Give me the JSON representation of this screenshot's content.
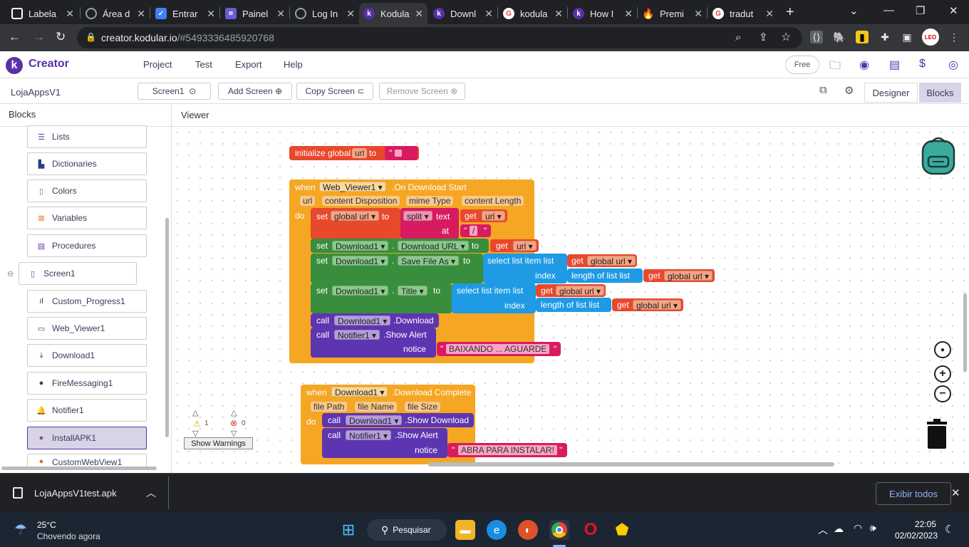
{
  "browser": {
    "tabs": [
      {
        "title": "Labela",
        "icon": "square-icon",
        "color": "#ffffff"
      },
      {
        "title": "Área d",
        "icon": "globe-icon",
        "color": "#9aa0a6"
      },
      {
        "title": "Entrar",
        "icon": "check-shield-icon",
        "color": "#3b82f6"
      },
      {
        "title": "Painel",
        "icon": "brackets-icon",
        "color": "#6b5bd6"
      },
      {
        "title": "Log In",
        "icon": "globe-icon",
        "color": "#9aa0a6"
      },
      {
        "title": "Kodula",
        "icon": "kodular-icon",
        "color": "#5930a5"
      },
      {
        "title": "Downl",
        "icon": "kodular-icon",
        "color": "#5930a5"
      },
      {
        "title": "kodula",
        "icon": "google-icon",
        "color": "#ea4335"
      },
      {
        "title": "How I",
        "icon": "kodular-icon",
        "color": "#5930a5"
      },
      {
        "title": "Premi",
        "icon": "flame-icon",
        "color": "#f59e0b"
      },
      {
        "title": "tradut",
        "icon": "google-icon",
        "color": "#ea4335"
      }
    ],
    "url_host": "creator.kodular.io",
    "url_path": "/#5493336485920768"
  },
  "app": {
    "brand": "Creator",
    "menu": [
      "Project",
      "Test",
      "Export",
      "Help"
    ],
    "plan_badge": "Free",
    "project_name": "LojaAppsV1",
    "screen_select": "Screen1",
    "add_screen": "Add Screen",
    "copy_screen": "Copy Screen",
    "remove_screen": "Remove Screen",
    "designer": "Designer",
    "blocks_mode": "Blocks"
  },
  "blocks_panel": {
    "title": "Blocks",
    "items": [
      {
        "label": "Lists",
        "icon": "list-icon",
        "color": "#3f51b5"
      },
      {
        "label": "Dictionaries",
        "icon": "dictionary-icon",
        "color": "#2d3a8c"
      },
      {
        "label": "Colors",
        "icon": "color-palette-icon",
        "color": "#777777"
      },
      {
        "label": "Variables",
        "icon": "variable-icon",
        "color": "#f0712c"
      },
      {
        "label": "Procedures",
        "icon": "procedure-icon",
        "color": "#6a3ab8"
      }
    ],
    "screen": "Screen1",
    "components": [
      {
        "label": "Custom_Progress1",
        "icon": "progress-icon"
      },
      {
        "label": "Web_Viewer1",
        "icon": "web-window-icon"
      },
      {
        "label": "Download1",
        "icon": "download-icon"
      },
      {
        "label": "FireMessaging1",
        "icon": "firebase-icon"
      },
      {
        "label": "Notifier1",
        "icon": "bell-icon"
      },
      {
        "label": "InstallAPK1",
        "icon": "extension-icon"
      },
      {
        "label": "CustomWebView1",
        "icon": "web-icon"
      }
    ]
  },
  "viewer": {
    "title": "Viewer",
    "warnings_count": "1",
    "errors_count": "0",
    "show_warnings": "Show Warnings"
  },
  "blocks": {
    "init_global": "initialize global",
    "var_url": "url",
    "to": "to",
    "str_empty": "\" \"",
    "when": "when",
    "web_viewer": "Web_Viewer1",
    "on_download_start": ".On Download Start",
    "params_start": [
      "url",
      "content Disposition",
      "mime Type",
      "content Length"
    ],
    "do": "do",
    "set": "set",
    "global_url": "global url",
    "split": "split",
    "text": "text",
    "at": "at",
    "get": "get",
    "slash": "/",
    "download1": "Download1",
    "download_url": "Download URL",
    "save_file_as": "Save File As",
    "title_prop": "Title",
    "select_list_item": "select list item  list",
    "index": "index",
    "length_of_list": "length of list  list",
    "call": "call",
    "download_method": ".Download",
    "notifier1": "Notifier1",
    "show_alert": ".Show Alert",
    "notice": "notice",
    "msg1": "BAIXANDO ... AGUARDE",
    "on_download_complete": ".Download Complete",
    "params_complete": [
      "file Path",
      "file Name",
      "file Size"
    ],
    "show_download": ".Show Download",
    "msg2": "ABRA PARA INSTALAR!"
  },
  "downloads": {
    "file": "LojaAppsV1test.apk",
    "show_all": "Exibir todos"
  },
  "taskbar": {
    "temp": "25°C",
    "weather": "Chovendo agora",
    "search": "Pesquisar",
    "time": "22:05",
    "date": "02/02/2023"
  }
}
